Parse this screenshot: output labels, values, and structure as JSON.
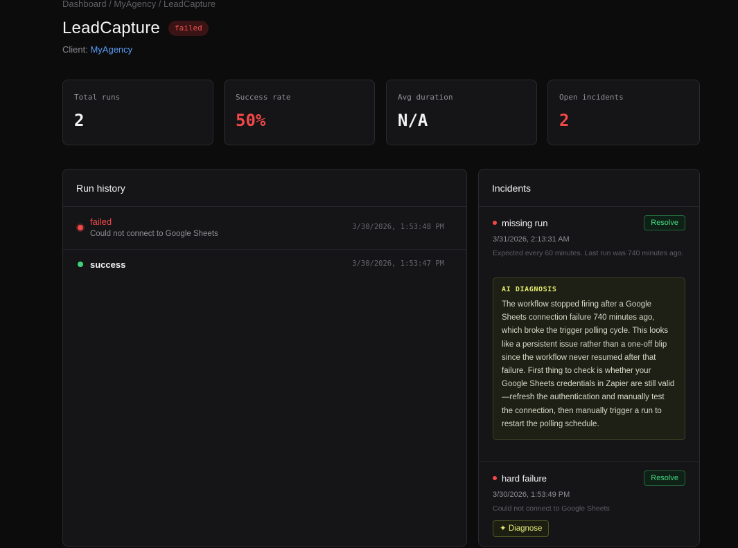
{
  "breadcrumb": "Dashboard / MyAgency / LeadCapture",
  "header": {
    "title": "LeadCapture",
    "status": "failed",
    "client_label": "Client: ",
    "client_name": "MyAgency"
  },
  "stats": [
    {
      "label": "Total runs",
      "value": "2"
    },
    {
      "label": "Success rate",
      "value": "50%"
    },
    {
      "label": "Avg duration",
      "value": "N/A"
    },
    {
      "label": "Open incidents",
      "value": "2"
    }
  ],
  "run_history": {
    "title": "Run history",
    "runs": [
      {
        "status": "failed",
        "message": "Could not connect to Google Sheets",
        "time": "3/30/2026, 1:53:48 PM"
      },
      {
        "status": "success",
        "message": "",
        "time": "3/30/2026, 1:53:47 PM"
      }
    ]
  },
  "incidents": {
    "title": "Incidents",
    "items": [
      {
        "title": "missing run",
        "time": "3/31/2026, 2:13:31 AM",
        "description": "Expected every 60 minutes. Last run was 740 minutes ago.",
        "resolve_label": "Resolve",
        "ai_label": "AI DIAGNOSIS",
        "ai_text": "The workflow stopped firing after a Google Sheets connection failure 740 minutes ago, which broke the trigger polling cycle. This looks like a persistent issue rather than a one-off blip since the workflow never resumed after that failure. First thing to check is whether your Google Sheets credentials in Zapier are still valid—refresh the authentication and manually test the connection, then manually trigger a run to restart the polling schedule."
      },
      {
        "title": "hard failure",
        "time": "3/30/2026, 1:53:49 PM",
        "description": "Could not connect to Google Sheets",
        "resolve_label": "Resolve",
        "diagnose_label": "✦ Diagnose"
      }
    ]
  },
  "colors": {
    "failed": "#f24848",
    "success": "#3ed47a",
    "link": "#5b9cf5",
    "ai_accent": "#e3ea6a"
  }
}
